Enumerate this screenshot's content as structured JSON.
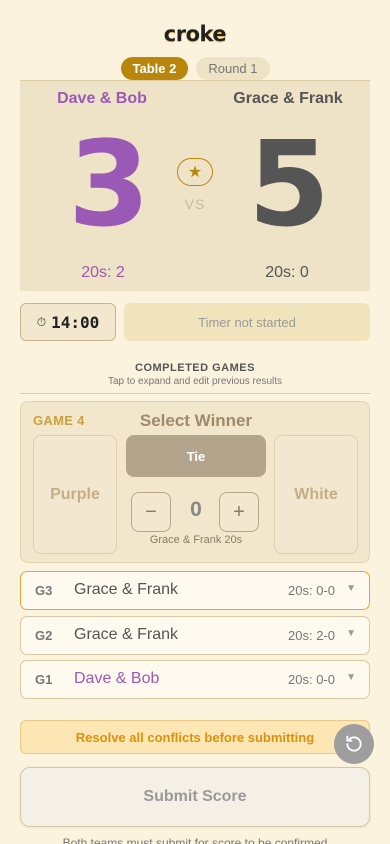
{
  "app": {
    "title": "croke"
  },
  "header": {
    "table_label": "Table 2",
    "round_label": "Round 1"
  },
  "scoreboard": {
    "left_team": "Dave & Bob",
    "right_team": "Grace & Frank",
    "left_score": "3",
    "right_score": "5",
    "vs_label": "VS",
    "left_twenties": "20s: 2",
    "right_twenties": "20s: 0",
    "star_icon": "star-icon"
  },
  "timer": {
    "value": "14:00",
    "status": "Timer not started",
    "icon": "stopwatch-icon"
  },
  "completed": {
    "title": "COMPLETED GAMES",
    "subtitle": "Tap to expand and edit previous results"
  },
  "current_game": {
    "label": "GAME 4",
    "heading": "Select Winner",
    "left_option": "Purple",
    "tie_option": "Tie",
    "right_option": "White",
    "twenties_value": "0",
    "twenties_label": "Grace & Frank 20s"
  },
  "games": [
    {
      "id": "G3",
      "winner": "Grace & Frank",
      "score": "20s: 0-0",
      "color": "#555555"
    },
    {
      "id": "G2",
      "winner": "Grace & Frank",
      "score": "20s: 2-0",
      "color": "#555555"
    },
    {
      "id": "G1",
      "winner": "Dave & Bob",
      "score": "20s: 0-0",
      "color": "#9b59b6"
    }
  ],
  "warning": "Resolve all conflicts before submitting",
  "submit_label": "Submit Score",
  "footnote": "Both teams must submit for score to be confirmed",
  "colors": {
    "purple": "#9b59b6",
    "gold": "#b8860b",
    "background": "#fcf3df",
    "warning": "#d9920c"
  }
}
